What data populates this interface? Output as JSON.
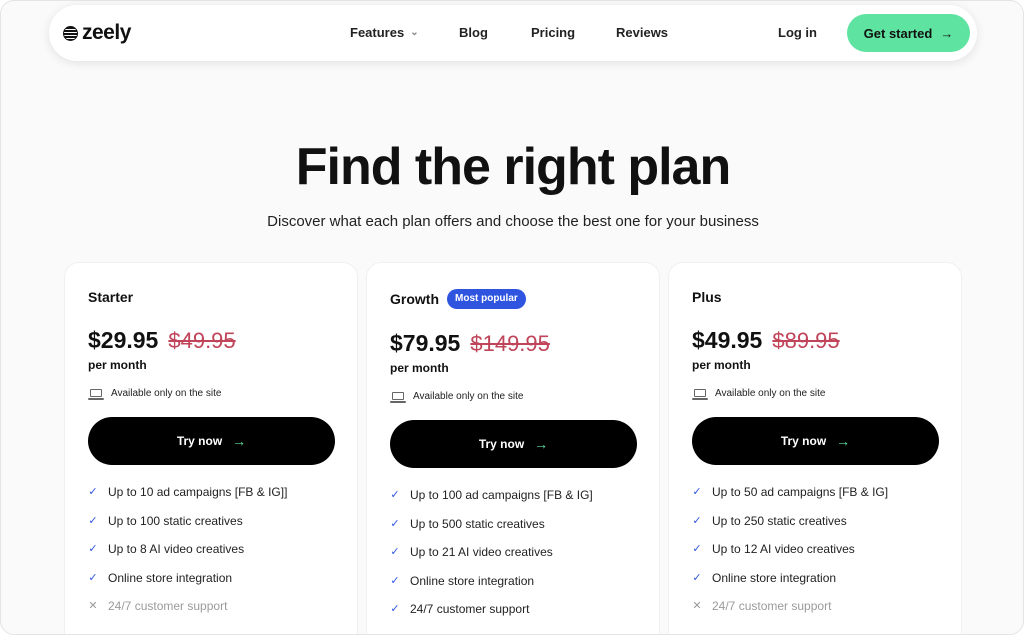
{
  "nav": {
    "logo_text": "zeely",
    "links": [
      "Features",
      "Blog",
      "Pricing",
      "Reviews"
    ],
    "login": "Log in",
    "cta": "Get started"
  },
  "hero": {
    "title": "Find the right plan",
    "subtitle": "Discover what each plan offers and choose the best one for your business"
  },
  "plans": [
    {
      "name": "Starter",
      "price": "$29.95",
      "old_price": "$49.95",
      "period": "per month",
      "availability": "Available only on the site",
      "button": "Try now",
      "features": [
        {
          "text": "Up to 10 ad campaigns [FB & IG]]",
          "included": true
        },
        {
          "text": "Up to 100 static creatives",
          "included": true
        },
        {
          "text": "Up to 8 AI video creatives",
          "included": true
        },
        {
          "text": "Online store integration",
          "included": true
        },
        {
          "text": "24/7 customer support",
          "included": false
        }
      ]
    },
    {
      "name": "Growth",
      "badge": "Most popular",
      "price": "$79.95",
      "old_price": "$149.95",
      "period": "per month",
      "availability": "Available only on the site",
      "button": "Try now",
      "features": [
        {
          "text": "Up to 100 ad campaigns [FB & IG]",
          "included": true
        },
        {
          "text": "Up to 500 static creatives",
          "included": true
        },
        {
          "text": "Up to 21 AI video creatives",
          "included": true
        },
        {
          "text": "Online store integration",
          "included": true
        },
        {
          "text": "24/7 customer support",
          "included": true
        }
      ]
    },
    {
      "name": "Plus",
      "price": "$49.95",
      "old_price": "$89.95",
      "period": "per month",
      "availability": "Available only on the site",
      "button": "Try now",
      "features": [
        {
          "text": "Up to 50 ad campaigns [FB & IG]",
          "included": true
        },
        {
          "text": "Up to 250 static creatives",
          "included": true
        },
        {
          "text": "Up to 12 AI video creatives",
          "included": true
        },
        {
          "text": "Online store integration",
          "included": true
        },
        {
          "text": "24/7 customer support",
          "included": false
        }
      ]
    }
  ],
  "colors": {
    "accent_green": "#5fe3a1",
    "badge_blue": "#2f55e0",
    "strike_red": "#c0455a"
  },
  "icons": {
    "logo": "zeely-logo-icon",
    "features_dropdown": "chevron-down-icon",
    "cta_arrow": "arrow-right-icon",
    "availability": "laptop-icon",
    "included": "check-icon",
    "excluded": "x-icon"
  }
}
